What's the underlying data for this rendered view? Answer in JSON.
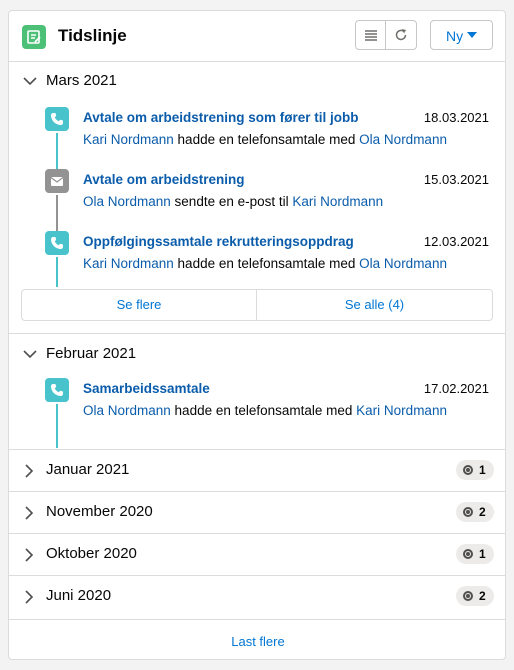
{
  "header": {
    "title": "Tidslinje",
    "new_label": "Ny"
  },
  "expanded_months": [
    {
      "label": "Mars 2021",
      "items": [
        {
          "type": "call",
          "subject": "Avtale om arbeidstrening som fører til jobb",
          "date": "18.03.2021",
          "actor": "Kari Nordmann",
          "verb": " hadde en telefonsamtale med ",
          "target": "Ola Nordmann"
        },
        {
          "type": "email",
          "subject": "Avtale om arbeidstrening",
          "date": "15.03.2021",
          "actor": "Ola Nordmann",
          "verb": " sendte en e-post til ",
          "target": "Kari Nordmann"
        },
        {
          "type": "call",
          "subject": "Oppfølgingssamtale rekrutteringsoppdrag",
          "date": "12.03.2021",
          "actor": "Kari Nordmann",
          "verb": " hadde en telefonsamtale med ",
          "target": "Ola Nordmann"
        }
      ],
      "see_more": "Se flere",
      "see_all": "Se alle (4)"
    },
    {
      "label": "Februar 2021",
      "items": [
        {
          "type": "call",
          "subject": "Samarbeidssamtale",
          "date": "17.02.2021",
          "actor": "Ola Nordmann",
          "verb": " hadde en telefonsamtale med ",
          "target": "Kari Nordmann"
        }
      ]
    }
  ],
  "collapsed_months": [
    {
      "label": "Januar 2021",
      "count": "1"
    },
    {
      "label": "November 2020",
      "count": "2"
    },
    {
      "label": "Oktober 2020",
      "count": "1"
    },
    {
      "label": "Juni 2020",
      "count": "2"
    }
  ],
  "footer": {
    "load_more": "Last flere"
  },
  "colors": {
    "accent": "#0176d3",
    "link": "#0b5cab",
    "call": "#48c3cc",
    "email": "#939393",
    "header_icon": "#4bc076"
  },
  "icons": {
    "header": "timeline-icon",
    "call": "phone-icon",
    "email": "envelope-icon"
  }
}
